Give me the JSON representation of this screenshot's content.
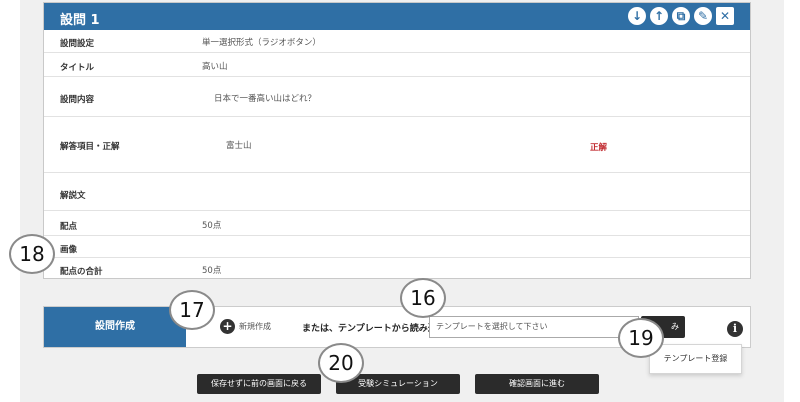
{
  "question": {
    "title": "設問 1",
    "header_icons": [
      "arrow-down-icon",
      "arrow-up-icon",
      "copy-icon",
      "edit-icon",
      "close-icon"
    ],
    "rows": {
      "setting": {
        "label": "設問設定",
        "value": "単一選択形式（ラジオボタン）"
      },
      "title": {
        "label": "タイトル",
        "value": "高い山"
      },
      "content": {
        "label": "設問内容",
        "value": "日本で一番高い山はどれ？"
      },
      "answer": {
        "label": "解答項目・正解",
        "value": "富士山",
        "correct_label": "正解"
      },
      "explanation": {
        "label": "解説文",
        "value": ""
      },
      "score": {
        "label": "配点",
        "value": "50点"
      },
      "image": {
        "label": "画像",
        "value": ""
      },
      "total": {
        "label": "配点の合計",
        "value": "50点"
      }
    }
  },
  "create_bar": {
    "tab_label": "設問作成",
    "new_label": "新規作成",
    "or_template_label": "または、テンプレートから読み込む",
    "template_placeholder": "テンプレートを選択して下さい",
    "load_button_label": "み",
    "dropdown_item": "テンプレート登録"
  },
  "footer_buttons": {
    "back": "保存せずに前の画面に戻る",
    "simulation": "受験シミュレーション",
    "confirm": "確認画面に進む"
  },
  "callouts": {
    "c16": "16",
    "c17": "17",
    "c18": "18",
    "c19": "19",
    "c20": "20"
  },
  "colors": {
    "header_blue": "#2f6fa5",
    "correct_red": "#c0282d",
    "dark_button": "#2b2b2b"
  }
}
